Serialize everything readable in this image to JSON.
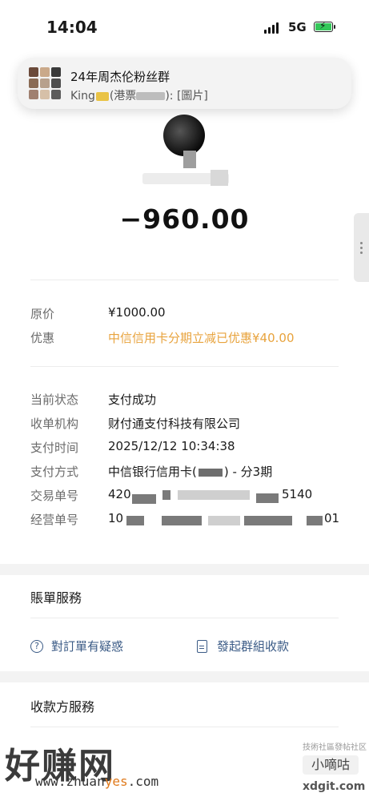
{
  "status_bar": {
    "time": "14:04",
    "network": "5G"
  },
  "notification": {
    "group_name": "24年周杰伦粉丝群",
    "sender": "King",
    "sender_detail": "(港票",
    "message_suffix": "): [圖片]"
  },
  "payment": {
    "amount": "−960.00"
  },
  "price_details": {
    "original_price_label": "原价",
    "original_price_value": "¥1000.00",
    "discount_label": "优惠",
    "discount_value": "中信信用卡分期立减已优惠¥40.00"
  },
  "transaction": {
    "status_label": "当前状态",
    "status_value": "支付成功",
    "institution_label": "收单机构",
    "institution_value": "财付通支付科技有限公司",
    "time_label": "支付时间",
    "time_value": "2025/12/12 10:34:38",
    "method_label": "支付方式",
    "method_prefix": "中信银行信用卡(",
    "method_suffix": ") - 分3期",
    "trade_no_label": "交易单号",
    "trade_no_start": "420",
    "trade_no_end": "5140",
    "merchant_no_label": "经营单号",
    "merchant_no_start": "10",
    "merchant_no_end": "01"
  },
  "bill_services": {
    "title": "賬單服務",
    "question_link": "對訂單有疑惑",
    "group_collect_link": "發起群組收款"
  },
  "payee_services": {
    "title": "收款方服務"
  },
  "watermarks": {
    "left_logo": "好赚网",
    "left_url_a": "www.zhuan",
    "left_url_b": "yes",
    "left_url_c": ".com",
    "right_small": "技術社區發帖社区",
    "right_logo": "小嘀咕",
    "right_url": "xdgit.com"
  },
  "colors": {
    "accent_orange": "#e8a33d",
    "link_blue": "#3b5b86",
    "battery_green": "#34c759"
  }
}
